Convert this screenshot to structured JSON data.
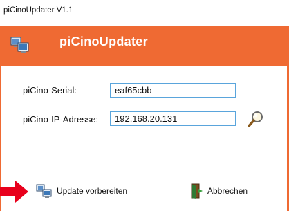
{
  "window": {
    "title": "piCinoUpdater V1.1"
  },
  "header": {
    "title": "piCinoUpdater",
    "logo_icon": "computers-network-icon",
    "color": "#ef6a33"
  },
  "form": {
    "serial_label": "piCino-Serial:",
    "serial_value": "eaf65cbb",
    "ip_label": "piCino-IP-Adresse:",
    "ip_value": "192.168.20.131",
    "search_icon": "magnifier-icon"
  },
  "buttons": {
    "prepare_label": "Update vorbereiten",
    "prepare_icon": "computers-network-icon",
    "cancel_label": "Abbrechen",
    "cancel_icon": "exit-door-icon"
  },
  "annotation": {
    "arrow_color": "#e8001c"
  }
}
